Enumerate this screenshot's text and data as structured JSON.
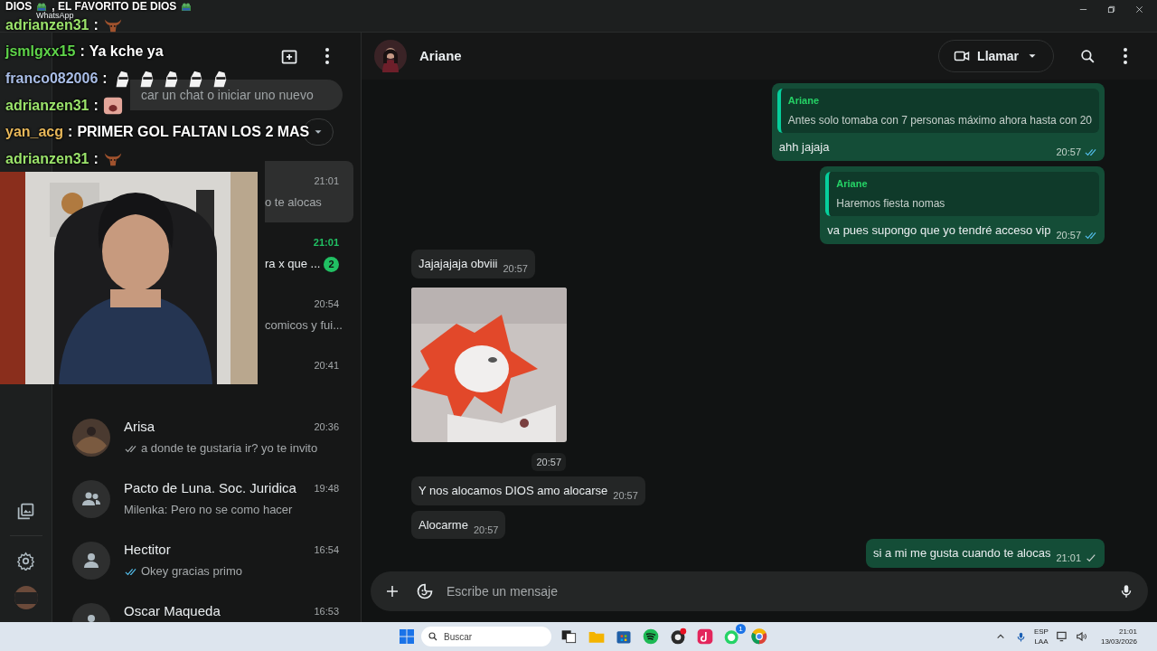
{
  "window": {
    "title": "WhatsApp"
  },
  "chat_list": {
    "search": {
      "placeholder": "car un chat o iniciar uno nuevo"
    },
    "items": [
      {
        "kind": "covered",
        "selected": true,
        "unread": false,
        "time": "21:01",
        "preview": "o te alocas"
      },
      {
        "kind": "covered",
        "selected": false,
        "unread": true,
        "time": "21:01",
        "preview": "ra x que ...",
        "badge": "2"
      },
      {
        "kind": "covered",
        "selected": false,
        "unread": false,
        "time": "20:54",
        "preview": "comicos y fui..."
      },
      {
        "kind": "covered",
        "selected": false,
        "unread": false,
        "time": "20:41"
      },
      {
        "selected": false,
        "unread": false,
        "name": "Arisa",
        "time": "20:36",
        "delivered": true,
        "read": false,
        "preview": "a donde te gustaria ir? yo te invito"
      },
      {
        "kind": "group",
        "selected": false,
        "unread": false,
        "name": "Pacto de Luna. Soc. Juridica",
        "time": "19:48",
        "preview": "Milenka: Pero no se como hacer"
      },
      {
        "kind": "person",
        "selected": false,
        "unread": false,
        "name": "Hectitor",
        "time": "16:54",
        "delivered": true,
        "read": true,
        "preview": "Okey gracias primo"
      },
      {
        "kind": "person",
        "selected": false,
        "unread": false,
        "name": "Oscar Maqueda",
        "time": "16:53"
      }
    ]
  },
  "chat": {
    "contact": "Ariane",
    "call_button": "Llamar",
    "messages": [
      {
        "kind": "text",
        "outgoing": true,
        "quote": {
          "author": "Ariane",
          "text": "Antes solo tomaba con 7 personas máximo ahora hasta con 20"
        },
        "text": "ahh jajaja",
        "time": "20:57",
        "delivered": true,
        "read": true
      },
      {
        "kind": "text",
        "outgoing": true,
        "quote": {
          "author": "Ariane",
          "text": "Haremos fiesta nomas"
        },
        "text": "va pues supongo que yo tendré acceso vip",
        "time": "20:57",
        "delivered": true,
        "read": true
      },
      {
        "kind": "text",
        "outgoing": false,
        "text": "Jajajajaja obviii",
        "time": "20:57"
      },
      {
        "outgoing": false,
        "time": "20:57"
      },
      {
        "kind": "text",
        "outgoing": false,
        "text": "Y nos alocamos DIOS amo alocarse",
        "time": "20:57"
      },
      {
        "kind": "text",
        "outgoing": false,
        "text": "Alocarme",
        "time": "20:57"
      },
      {
        "kind": "text",
        "outgoing": true,
        "text": "si a mi me gusta cuando te alocas",
        "time": "21:01",
        "delivered": false,
        "read": false
      }
    ],
    "composer": {
      "placeholder": "Escribe un mensaje"
    }
  },
  "stream_chat": [
    {
      "parts": [
        {
          "kind": "text",
          "text": "DIOS"
        },
        {
          "kind": "frog"
        },
        {
          "kind": "text",
          "text": ", EL FAVORITO DE DIOS"
        },
        {
          "kind": "frog"
        }
      ]
    },
    {
      "user": "adrianzen31",
      "color": "#9be36b",
      "separator": ":",
      "parts": [
        {
          "kind": "bull"
        }
      ]
    },
    {
      "user": "jsmlgxx15",
      "color": "#5fd44a",
      "separator": ":",
      "parts": [
        {
          "kind": "text",
          "text": "Ya kche ya"
        }
      ]
    },
    {
      "user": "franco082006",
      "color": "#a9bde6",
      "separator": ":",
      "parts": [
        {
          "kind": "hand"
        },
        {
          "kind": "hand"
        },
        {
          "kind": "hand"
        },
        {
          "kind": "hand"
        },
        {
          "kind": "hand"
        }
      ]
    },
    {
      "user": "adrianzen31",
      "color": "#9be36b",
      "separator": ":",
      "parts": [
        {
          "kind": "face"
        }
      ]
    },
    {
      "user": "yan_acg",
      "color": "#e8b85a",
      "separator": ":",
      "parts": [
        {
          "kind": "text",
          "text": "PRIMER GOL FALTAN LOS 2 MAS"
        }
      ]
    },
    {
      "user": "adrianzen31",
      "color": "#9be36b",
      "separator": ":",
      "parts": [
        {
          "kind": "bull"
        }
      ]
    }
  ],
  "taskbar": {
    "search": "Buscar",
    "whatsapp_badge": "1",
    "language": "ESP",
    "layout": "LAA",
    "time": "21:01",
    "date": "13/03/2026"
  }
}
